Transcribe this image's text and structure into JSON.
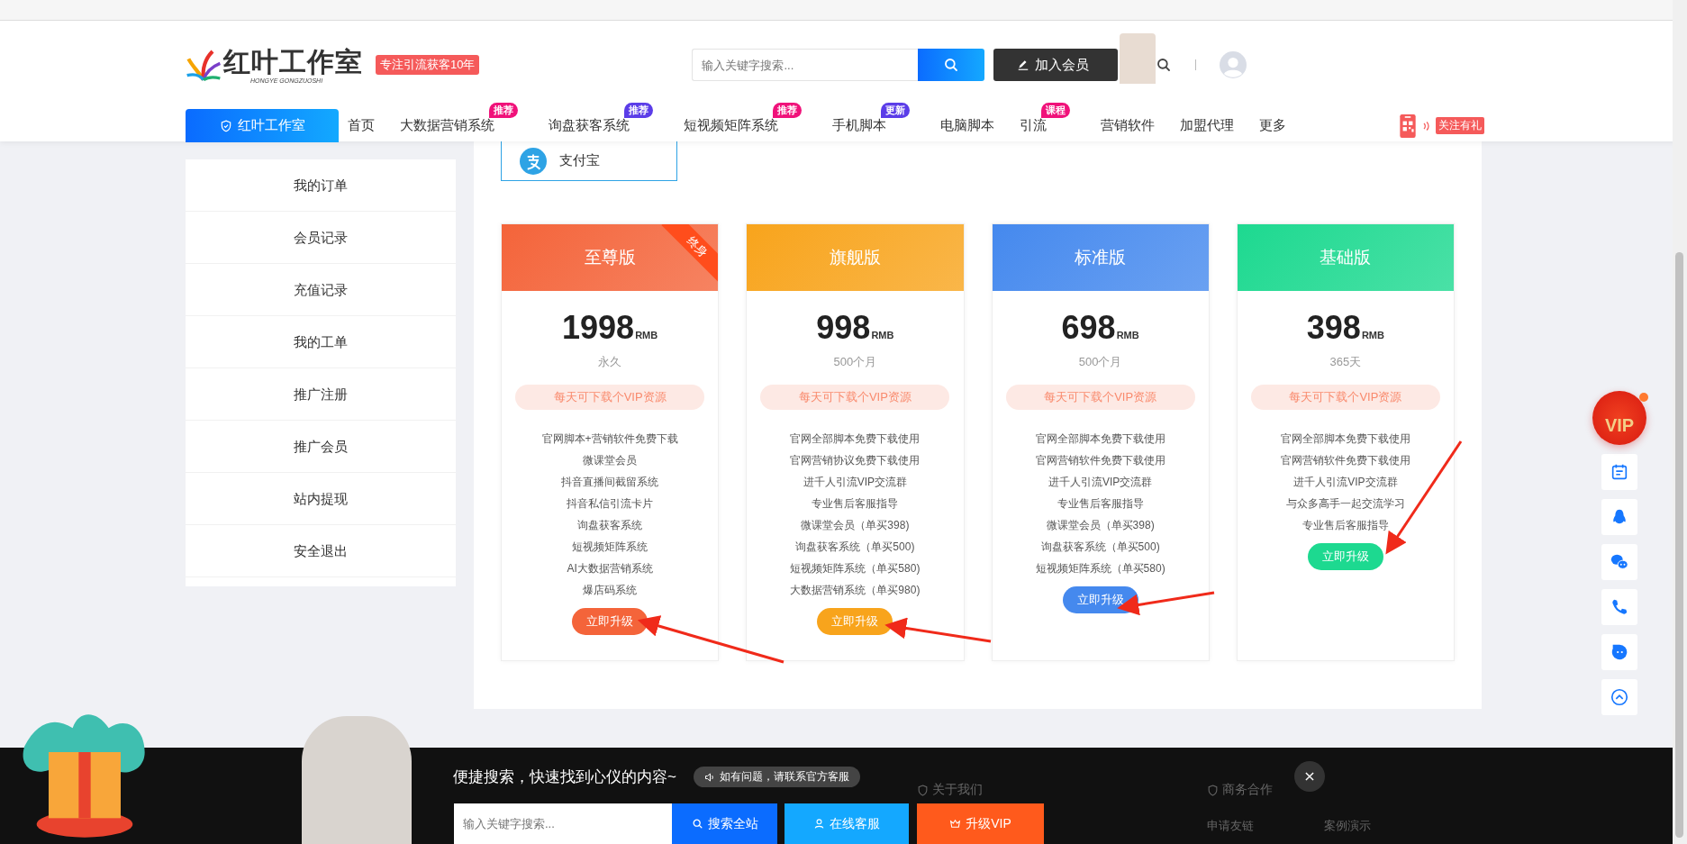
{
  "header": {
    "logo_text": "红叶工作室",
    "logo_subtitle": "HONGYE GONGZUOSHI",
    "slogan_badge": "专注引流获客10年",
    "search": {
      "placeholder": "输入关键字搜索..."
    },
    "join_button": "加入会员"
  },
  "nav": {
    "home_tab": "红叶工作室",
    "items": [
      {
        "label": "首页"
      },
      {
        "label": "大数据营销系统",
        "badge": "推荐",
        "color": "#f0127a"
      },
      {
        "label": "询盘获客系统",
        "badge": "推荐",
        "color": "#5b3de8"
      },
      {
        "label": "短视频矩阵系统",
        "badge": "推荐",
        "color": "#f0127a"
      },
      {
        "label": "手机脚本",
        "badge": "更新",
        "color": "#5b3de8"
      },
      {
        "label": "电脑脚本"
      },
      {
        "label": "引流",
        "badge": "课程",
        "color": "#f0127a"
      },
      {
        "label": "营销软件"
      },
      {
        "label": "加盟代理"
      },
      {
        "label": "更多"
      }
    ],
    "follow_badge": "关注有礼"
  },
  "sidebar": {
    "items": [
      "我的订单",
      "会员记录",
      "充值记录",
      "我的工单",
      "推广注册",
      "推广会员",
      "站内提现",
      "安全退出"
    ]
  },
  "payment": {
    "method": "支付宝"
  },
  "plans": [
    {
      "title": "至尊版",
      "color": "#f4643a",
      "ribbon": "终身",
      "price": "1998",
      "unit": "RMB",
      "period": "永久",
      "quota": "每天可下载个VIP资源",
      "features": [
        "官网脚本+营销软件免费下载",
        "微课堂会员",
        "抖音直播间截留系统",
        "抖音私信引流卡片",
        "询盘获客系统",
        "短视频矩阵系统",
        "AI大数据营销系统",
        "爆店码系统"
      ],
      "button": "立即升级"
    },
    {
      "title": "旗舰版",
      "color": "#f8a41c",
      "price": "998",
      "unit": "RMB",
      "period": "500个月",
      "quota": "每天可下载个VIP资源",
      "features": [
        "官网全部脚本免费下载使用",
        "官网营销协议免费下载使用",
        "进千人引流VIP交流群",
        "专业售后客服指导",
        "微课堂会员（单买398)",
        "询盘获客系统（单买500)",
        "短视频矩阵系统（单买580)",
        "大数据营销系统（单买980)"
      ],
      "button": "立即升级"
    },
    {
      "title": "标准版",
      "color": "#4589ee",
      "price": "698",
      "unit": "RMB",
      "period": "500个月",
      "quota": "每天可下载个VIP资源",
      "features": [
        "官网全部脚本免费下载使用",
        "官网营销软件免费下载使用",
        "进千人引流VIP交流群",
        "专业售后客服指导",
        "微课堂会员（单买398)",
        "询盘获客系统（单买500)",
        "短视频矩阵系统（单买580)"
      ],
      "button": "立即升级"
    },
    {
      "title": "基础版",
      "color": "#1dd990",
      "price": "398",
      "unit": "RMB",
      "period": "365天",
      "quota": "每天可下载个VIP资源",
      "features": [
        "官网全部脚本免费下载使用",
        "官网营销软件免费下载使用",
        "进千人引流VIP交流群",
        "与众多高手一起交流学习",
        "专业售后客服指导"
      ],
      "button": "立即升级"
    }
  ],
  "float_bar": {
    "vip_badge": "VIP"
  },
  "footer": {
    "columns": [
      {
        "title": "关于我们"
      },
      {
        "title": "商务合作",
        "links": [
          "申请友链",
          "案例演示"
        ]
      }
    ]
  },
  "promo_bar": {
    "headline": "便捷搜索，快速找到心仪的内容~",
    "notice": "如有问题，请联系官方客服",
    "search": {
      "placeholder": "输入关键字搜索..."
    },
    "buttons": [
      {
        "kind": "search",
        "label": "搜索全站"
      },
      {
        "kind": "service",
        "label": "在线客服"
      },
      {
        "kind": "vip",
        "label": "升级VIP"
      }
    ]
  }
}
